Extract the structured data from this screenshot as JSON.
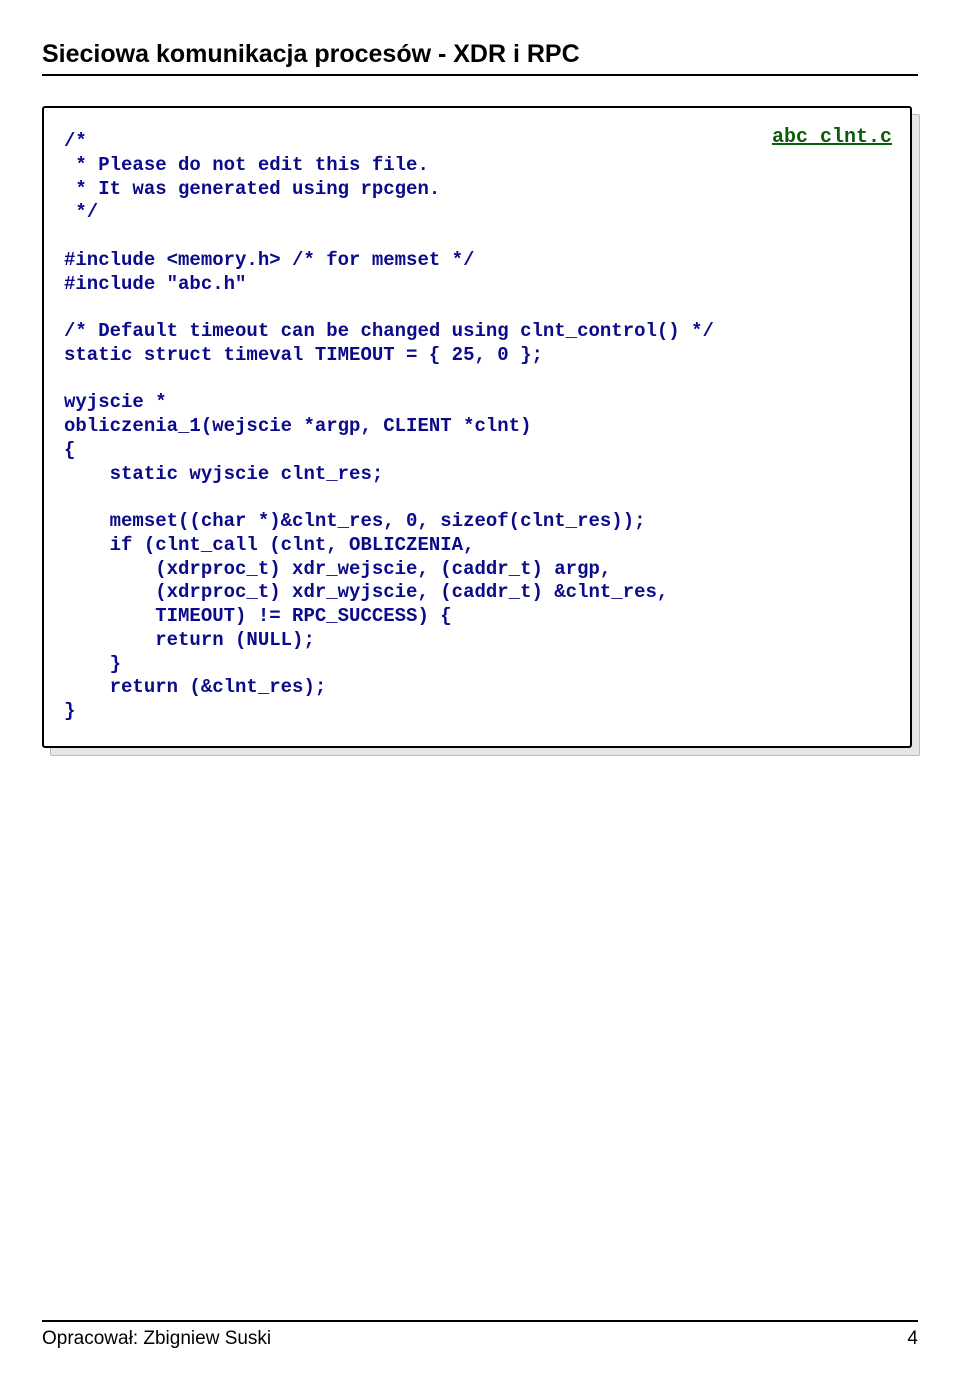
{
  "header": {
    "title": "Sieciowa komunikacja procesów - XDR i RPC"
  },
  "code": {
    "filename": "abc_clnt.c",
    "body": "/*\n * Please do not edit this file.\n * It was generated using rpcgen.\n */\n\n#include <memory.h> /* for memset */\n#include \"abc.h\"\n\n/* Default timeout can be changed using clnt_control() */\nstatic struct timeval TIMEOUT = { 25, 0 };\n\nwyjscie *\nobliczenia_1(wejscie *argp, CLIENT *clnt)\n{\n    static wyjscie clnt_res;\n\n    memset((char *)&clnt_res, 0, sizeof(clnt_res));\n    if (clnt_call (clnt, OBLICZENIA,\n        (xdrproc_t) xdr_wejscie, (caddr_t) argp,\n        (xdrproc_t) xdr_wyjscie, (caddr_t) &clnt_res,\n        TIMEOUT) != RPC_SUCCESS) {\n        return (NULL);\n    }\n    return (&clnt_res);\n}"
  },
  "footer": {
    "author_label": "Opracował: Zbigniew Suski",
    "page_number": "4"
  }
}
